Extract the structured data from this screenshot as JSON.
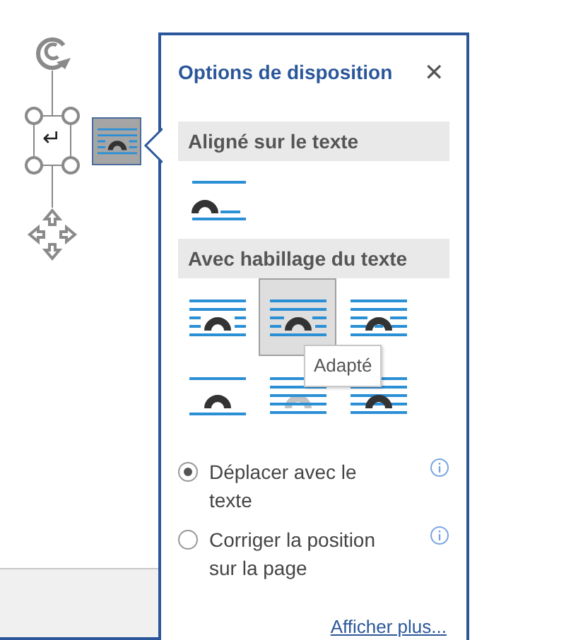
{
  "anchor_mark": "↵",
  "layout_button": {
    "kind": "square",
    "selected": true
  },
  "panel": {
    "title": "Options de disposition",
    "close": "✕",
    "sections": [
      {
        "title": "Aligné sur le texte",
        "options": [
          {
            "kind": "inline",
            "selected": false
          }
        ]
      },
      {
        "title": "Avec habillage du texte",
        "options": [
          {
            "kind": "square",
            "selected": false
          },
          {
            "kind": "tight",
            "selected": true
          },
          {
            "kind": "through",
            "selected": false
          },
          {
            "kind": "topbottom",
            "selected": false
          },
          {
            "kind": "behind",
            "selected": false
          },
          {
            "kind": "front",
            "selected": false
          }
        ]
      }
    ],
    "tooltip": "Adapté",
    "radios": [
      {
        "label": "Déplacer avec le texte",
        "selected": true
      },
      {
        "label": "Corriger la position sur la page",
        "selected": false
      }
    ],
    "link": "Afficher plus..."
  }
}
